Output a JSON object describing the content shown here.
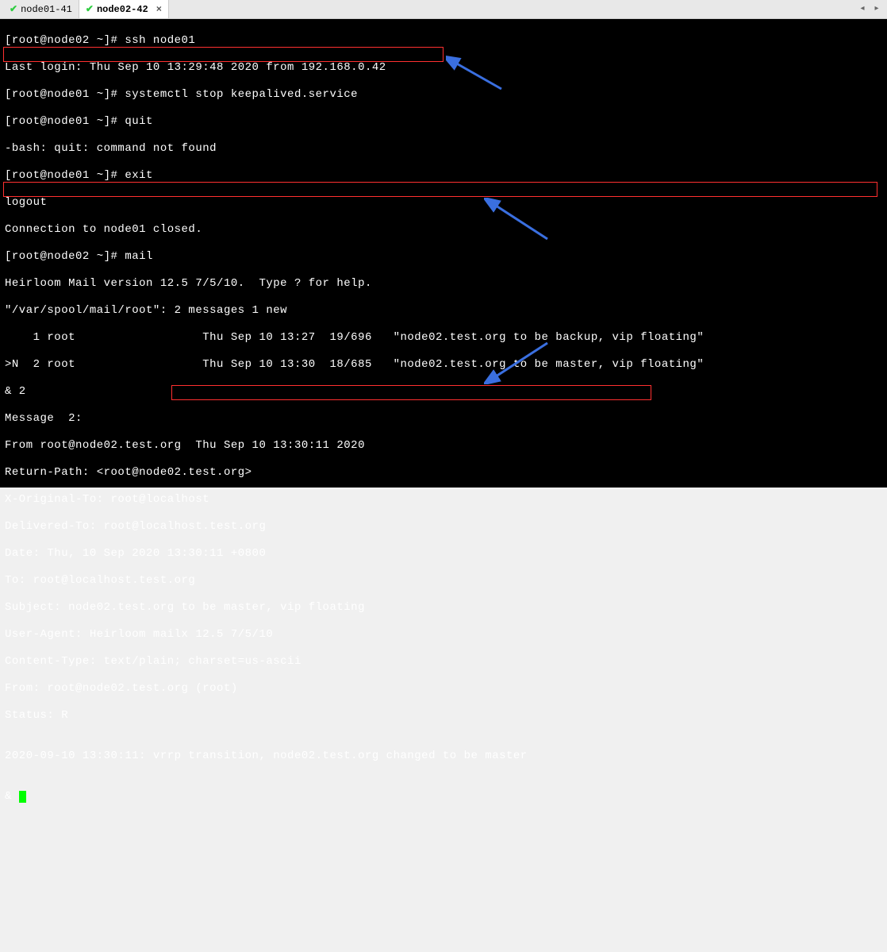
{
  "tabs": [
    {
      "label": "node01-41",
      "active": false
    },
    {
      "label": "node02-42",
      "active": true
    }
  ],
  "term": {
    "l1": "[root@node02 ~]# ssh node01",
    "l2": "Last login: Thu Sep 10 13:29:48 2020 from 192.168.0.42",
    "l3": "[root@node01 ~]# systemctl stop keepalived.service",
    "l4": "[root@node01 ~]# quit",
    "l5": "-bash: quit: command not found",
    "l6": "[root@node01 ~]# exit",
    "l7": "logout",
    "l8": "Connection to node01 closed.",
    "l9": "[root@node02 ~]# mail",
    "l10": "Heirloom Mail version 12.5 7/5/10.  Type ? for help.",
    "l11": "\"/var/spool/mail/root\": 2 messages 1 new",
    "l12": "    1 root                  Thu Sep 10 13:27  19/696   \"node02.test.org to be backup, vip floating\"",
    "l13": ">N  2 root                  Thu Sep 10 13:30  18/685   \"node02.test.org to be master, vip floating\"",
    "l14": "& 2",
    "l15": "Message  2:",
    "l16": "From root@node02.test.org  Thu Sep 10 13:30:11 2020",
    "l17": "Return-Path: <root@node02.test.org>",
    "l18": "X-Original-To: root@localhost",
    "l19": "Delivered-To: root@localhost.test.org",
    "l20": "Date: Thu, 10 Sep 2020 13:30:11 +0800",
    "l21": "To: root@localhost.test.org",
    "l22": "Subject: node02.test.org to be master, vip floating",
    "l23": "User-Agent: Heirloom mailx 12.5 7/5/10",
    "l24": "Content-Type: text/plain; charset=us-ascii",
    "l25": "From: root@node02.test.org (root)",
    "l26": "Status: R",
    "l27": "",
    "l28": "2020-09-10 13:30:11: vrrp transition, node02.test.org changed to be master",
    "l29": "",
    "l30": "& "
  },
  "annotations": {
    "box1_note": "highlights systemctl stop keepalived.service command",
    "box2_note": "highlights new mail message row about master vip floating",
    "box3_note": "highlights vrrp transition changed to be master text"
  }
}
